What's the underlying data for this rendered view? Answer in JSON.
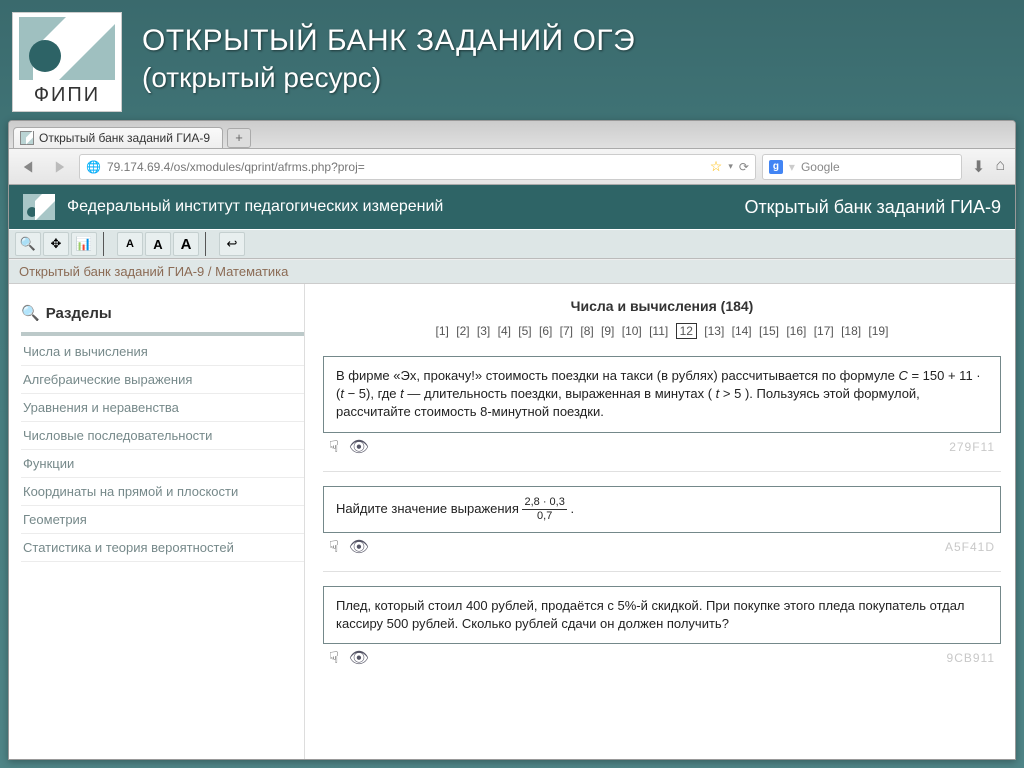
{
  "header": {
    "title_line1": "ОТКРЫТЫЙ БАНК ЗАДАНИЙ ОГЭ",
    "title_line2": "(открытый ресурс)",
    "fipi": "ФИПИ"
  },
  "browser": {
    "tab_title": "Открытый банк заданий ГИА-9",
    "url": "79.174.69.4/os/xmodules/qprint/afrms.php?proj=",
    "search_placeholder": "Google"
  },
  "site": {
    "left_title": "Федеральный институт педагогических измерений",
    "right_title": "Открытый банк заданий ГИА-9",
    "breadcrumb": "Открытый банк заданий ГИА-9 / Математика"
  },
  "sidebar": {
    "title": "Разделы",
    "items": [
      "Числа и вычисления",
      "Алгебраические выражения",
      "Уравнения и неравенства",
      "Числовые последовательности",
      "Функции",
      "Координаты на прямой и плоскости",
      "Геометрия",
      "Статистика и теория вероятностей"
    ]
  },
  "section": {
    "heading": "Числа и вычисления (184)",
    "pages": [
      "[1]",
      "[2]",
      "[3]",
      "[4]",
      "[5]",
      "[6]",
      "[7]",
      "[8]",
      "[9]",
      "[10]",
      "[11]",
      "12",
      "[13]",
      "[14]",
      "[15]",
      "[16]",
      "[17]",
      "[18]",
      "[19]"
    ],
    "current_page_index": 11
  },
  "tasks": [
    {
      "text_html": "В фирме «Эх, прокачу!» стоимость поездки на такси (в рублях) рассчитывается по формуле <span class='italic'>C</span> = 150 + 11 · (<span class='italic'>t</span> − 5), где <span class='italic'>t</span>  —  длительность поездки, выраженная в минутах ( <span class='italic'>t</span> > 5 ). Пользуясь этой формулой, рассчитайте стоимость 8-минутной поездки.",
      "id": "279F11"
    },
    {
      "text_html": "Найдите значение выражения <span class='frac'><span class='top'>2,8 · 0,3</span><span class='bot'>0,7</span></span> .",
      "id": "A5F41D"
    },
    {
      "text_html": "Плед, который стоил 400 рублей, продаётся с 5%-й скидкой. При покупке этого пледа покупатель отдал кассиру 500 рублей. Сколько рублей сдачи он должен получить?",
      "id": "9CB911"
    }
  ]
}
